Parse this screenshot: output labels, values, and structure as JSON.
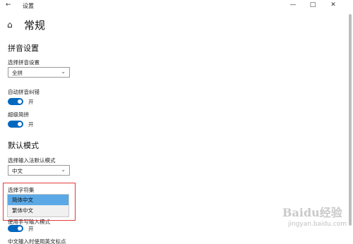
{
  "window": {
    "back_icon": "←",
    "title": "设置",
    "min_icon": "—",
    "max_icon": "□",
    "close_icon": "✕"
  },
  "header": {
    "home_icon": "⌂",
    "title": "常规"
  },
  "pinyin": {
    "section_title": "拼音设置",
    "select_label": "选择拼音设置",
    "select_value": "全拼",
    "autocorrect_label": "自动拼音纠错",
    "autocorrect_state": "开",
    "super_simple_label": "超级简拼",
    "super_simple_state": "开"
  },
  "default_mode": {
    "section_title": "默认模式",
    "mode_label": "选择输入法默认模式",
    "mode_value": "中文",
    "charset_label": "选择字符集",
    "charset_options": [
      "简体中文",
      "繁体中文"
    ],
    "partial_label": "使用手写输入模式",
    "partial_state": "开",
    "bottom_label": "中文输入时使用英文标点"
  },
  "watermark": {
    "brand": "Baidu经验",
    "url": "jingyan.baidu.com"
  },
  "colors": {
    "accent": "#0067c0",
    "highlight_border": "#e23b3b",
    "selected_option": "#5aa9e6"
  }
}
